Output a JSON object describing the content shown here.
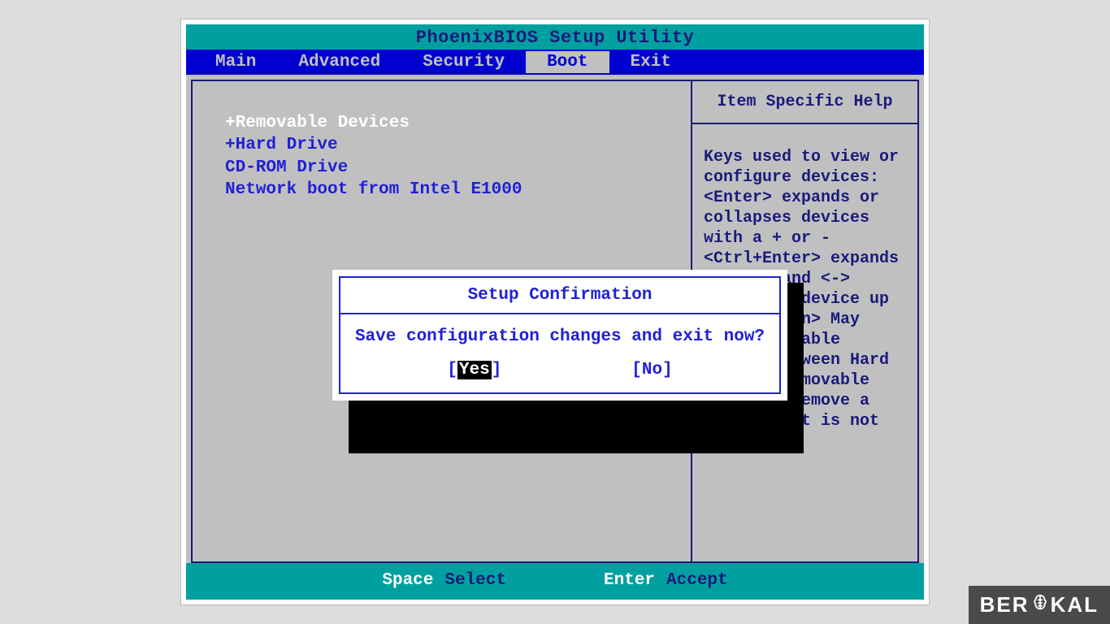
{
  "title": "PhoenixBIOS Setup Utility",
  "menu": {
    "items": [
      "Main",
      "Advanced",
      "Security",
      "Boot",
      "Exit"
    ],
    "active_index": 3
  },
  "boot_list": [
    {
      "label": "+Removable Devices",
      "selected": true
    },
    {
      "label": "+Hard Drive",
      "selected": false
    },
    {
      "label": " CD-ROM Drive",
      "selected": false
    },
    {
      "label": " Network boot from Intel E1000",
      "selected": false
    }
  ],
  "help": {
    "title": "Item Specific Help",
    "body": "Keys used to view or configure devices:\n<Enter> expands or collapses devices with a + or -\n<Ctrl+Enter> expands all\n<+> and <-> moves the device up or down.\n<n> May move removable device between Hard Disk or Removable Disk\n<d> Remove a device that is not installed."
  },
  "footer": [
    {
      "key": "Space",
      "action": "Select"
    },
    {
      "key": "Enter",
      "action": "Accept"
    }
  ],
  "dialog": {
    "title": "Setup Confirmation",
    "message": "Save configuration changes and exit now?",
    "buttons": [
      {
        "label": "Yes",
        "selected": true
      },
      {
        "label": "No",
        "selected": false
      }
    ]
  },
  "watermark": {
    "pre": "BER",
    "post": "KAL"
  }
}
